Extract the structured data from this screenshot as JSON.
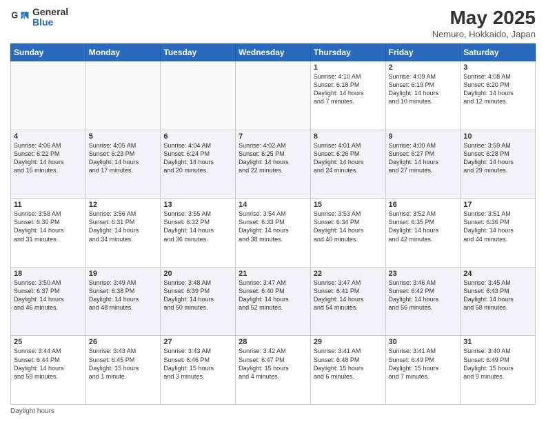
{
  "header": {
    "logo_general": "General",
    "logo_blue": "Blue",
    "month_title": "May 2025",
    "location": "Nemuro, Hokkaido, Japan"
  },
  "days_of_week": [
    "Sunday",
    "Monday",
    "Tuesday",
    "Wednesday",
    "Thursday",
    "Friday",
    "Saturday"
  ],
  "weeks": [
    [
      {
        "day": "",
        "info": ""
      },
      {
        "day": "",
        "info": ""
      },
      {
        "day": "",
        "info": ""
      },
      {
        "day": "",
        "info": ""
      },
      {
        "day": "1",
        "info": "Sunrise: 4:10 AM\nSunset: 6:18 PM\nDaylight: 14 hours\nand 7 minutes."
      },
      {
        "day": "2",
        "info": "Sunrise: 4:09 AM\nSunset: 6:19 PM\nDaylight: 14 hours\nand 10 minutes."
      },
      {
        "day": "3",
        "info": "Sunrise: 4:08 AM\nSunset: 6:20 PM\nDaylight: 14 hours\nand 12 minutes."
      }
    ],
    [
      {
        "day": "4",
        "info": "Sunrise: 4:06 AM\nSunset: 6:22 PM\nDaylight: 14 hours\nand 15 minutes."
      },
      {
        "day": "5",
        "info": "Sunrise: 4:05 AM\nSunset: 6:23 PM\nDaylight: 14 hours\nand 17 minutes."
      },
      {
        "day": "6",
        "info": "Sunrise: 4:04 AM\nSunset: 6:24 PM\nDaylight: 14 hours\nand 20 minutes."
      },
      {
        "day": "7",
        "info": "Sunrise: 4:02 AM\nSunset: 6:25 PM\nDaylight: 14 hours\nand 22 minutes."
      },
      {
        "day": "8",
        "info": "Sunrise: 4:01 AM\nSunset: 6:26 PM\nDaylight: 14 hours\nand 24 minutes."
      },
      {
        "day": "9",
        "info": "Sunrise: 4:00 AM\nSunset: 6:27 PM\nDaylight: 14 hours\nand 27 minutes."
      },
      {
        "day": "10",
        "info": "Sunrise: 3:59 AM\nSunset: 6:28 PM\nDaylight: 14 hours\nand 29 minutes."
      }
    ],
    [
      {
        "day": "11",
        "info": "Sunrise: 3:58 AM\nSunset: 6:30 PM\nDaylight: 14 hours\nand 31 minutes."
      },
      {
        "day": "12",
        "info": "Sunrise: 3:56 AM\nSunset: 6:31 PM\nDaylight: 14 hours\nand 34 minutes."
      },
      {
        "day": "13",
        "info": "Sunrise: 3:55 AM\nSunset: 6:32 PM\nDaylight: 14 hours\nand 36 minutes."
      },
      {
        "day": "14",
        "info": "Sunrise: 3:54 AM\nSunset: 6:33 PM\nDaylight: 14 hours\nand 38 minutes."
      },
      {
        "day": "15",
        "info": "Sunrise: 3:53 AM\nSunset: 6:34 PM\nDaylight: 14 hours\nand 40 minutes."
      },
      {
        "day": "16",
        "info": "Sunrise: 3:52 AM\nSunset: 6:35 PM\nDaylight: 14 hours\nand 42 minutes."
      },
      {
        "day": "17",
        "info": "Sunrise: 3:51 AM\nSunset: 6:36 PM\nDaylight: 14 hours\nand 44 minutes."
      }
    ],
    [
      {
        "day": "18",
        "info": "Sunrise: 3:50 AM\nSunset: 6:37 PM\nDaylight: 14 hours\nand 46 minutes."
      },
      {
        "day": "19",
        "info": "Sunrise: 3:49 AM\nSunset: 6:38 PM\nDaylight: 14 hours\nand 48 minutes."
      },
      {
        "day": "20",
        "info": "Sunrise: 3:48 AM\nSunset: 6:39 PM\nDaylight: 14 hours\nand 50 minutes."
      },
      {
        "day": "21",
        "info": "Sunrise: 3:47 AM\nSunset: 6:40 PM\nDaylight: 14 hours\nand 52 minutes."
      },
      {
        "day": "22",
        "info": "Sunrise: 3:47 AM\nSunset: 6:41 PM\nDaylight: 14 hours\nand 54 minutes."
      },
      {
        "day": "23",
        "info": "Sunrise: 3:46 AM\nSunset: 6:42 PM\nDaylight: 14 hours\nand 56 minutes."
      },
      {
        "day": "24",
        "info": "Sunrise: 3:45 AM\nSunset: 6:43 PM\nDaylight: 14 hours\nand 58 minutes."
      }
    ],
    [
      {
        "day": "25",
        "info": "Sunrise: 3:44 AM\nSunset: 6:44 PM\nDaylight: 14 hours\nand 59 minutes."
      },
      {
        "day": "26",
        "info": "Sunrise: 3:43 AM\nSunset: 6:45 PM\nDaylight: 15 hours\nand 1 minute."
      },
      {
        "day": "27",
        "info": "Sunrise: 3:43 AM\nSunset: 6:46 PM\nDaylight: 15 hours\nand 3 minutes."
      },
      {
        "day": "28",
        "info": "Sunrise: 3:42 AM\nSunset: 6:47 PM\nDaylight: 15 hours\nand 4 minutes."
      },
      {
        "day": "29",
        "info": "Sunrise: 3:41 AM\nSunset: 6:48 PM\nDaylight: 15 hours\nand 6 minutes."
      },
      {
        "day": "30",
        "info": "Sunrise: 3:41 AM\nSunset: 6:49 PM\nDaylight: 15 hours\nand 7 minutes."
      },
      {
        "day": "31",
        "info": "Sunrise: 3:40 AM\nSunset: 6:49 PM\nDaylight: 15 hours\nand 9 minutes."
      }
    ]
  ],
  "footer": {
    "note": "Daylight hours"
  }
}
